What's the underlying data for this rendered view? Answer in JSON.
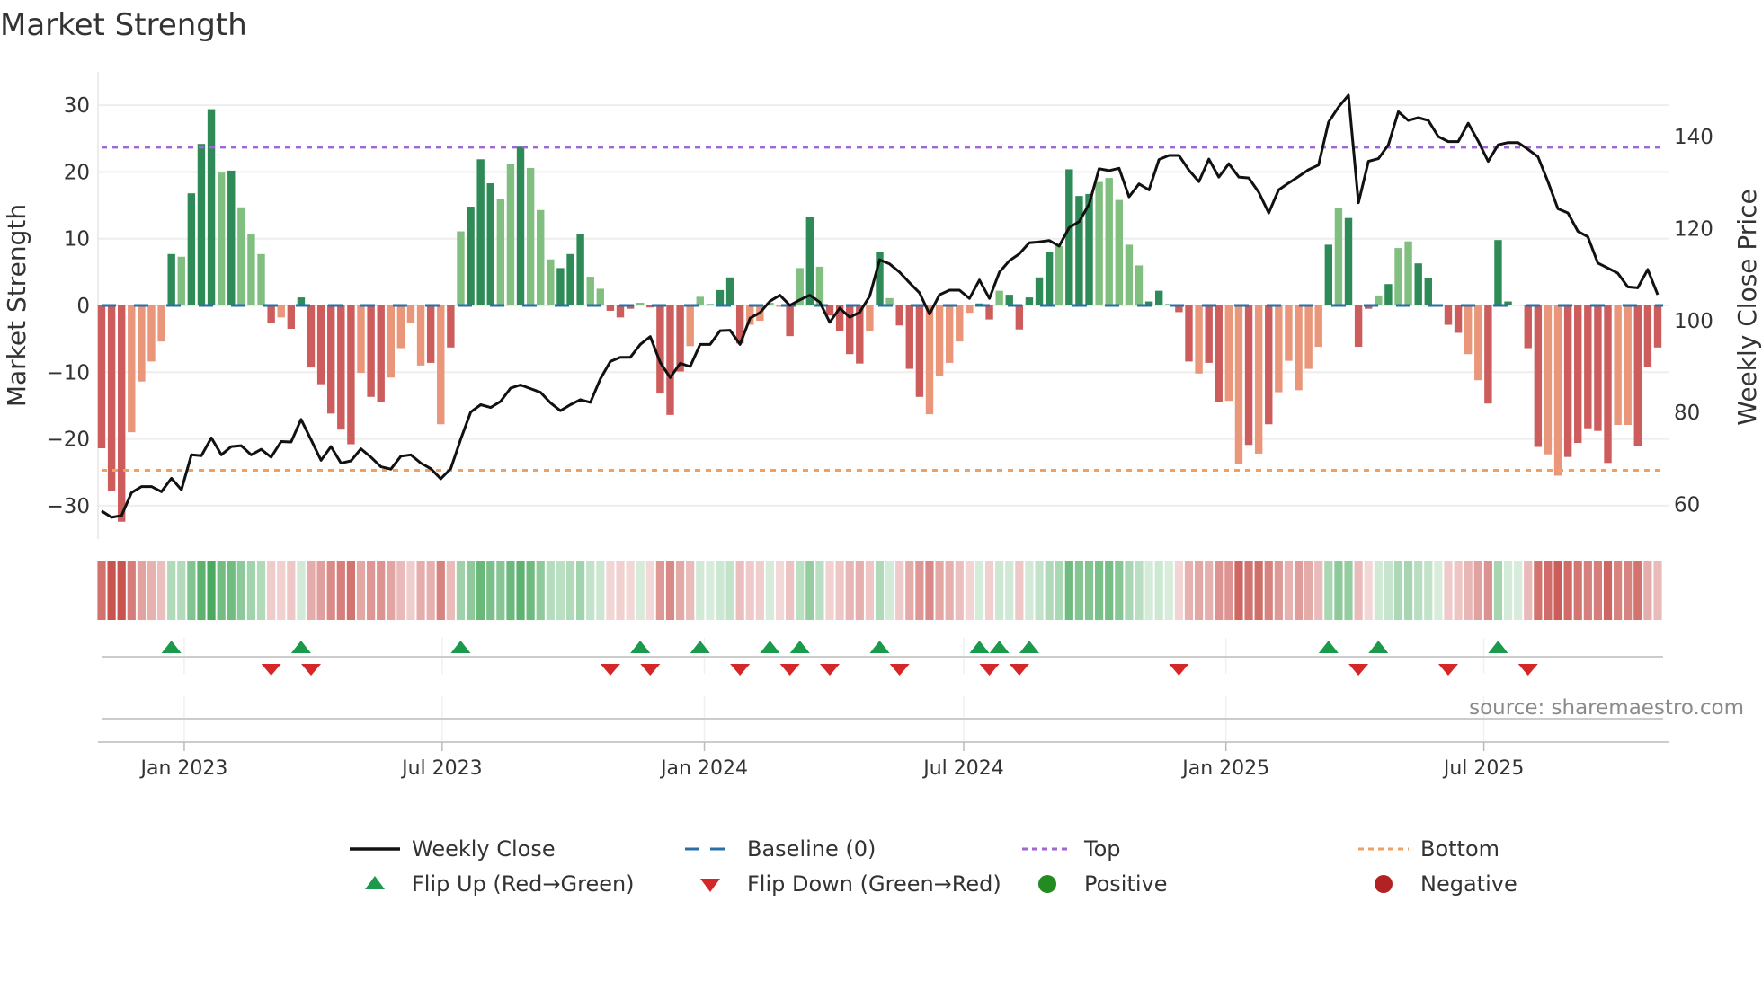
{
  "title": "Market Strength",
  "source": "source: sharemaestro.com",
  "colors": {
    "pos_dark": "#2e8b57",
    "pos_light": "#80bf80",
    "neg_dark": "#cd5c5c",
    "neg_light": "#e9967a",
    "close": "#111111",
    "baseline": "#2a6fa8",
    "top": "#a066d3",
    "bottom": "#f0a060",
    "flip_up": "#1a9a4a",
    "flip_down": "#d62728",
    "positive": "#228b22",
    "negative": "#b22222"
  },
  "legend": [
    {
      "label": "Weekly Close",
      "icon": "line-icon"
    },
    {
      "label": "Baseline (0)",
      "icon": "dashed-line-icon"
    },
    {
      "label": "Top",
      "icon": "dotted-line-icon"
    },
    {
      "label": "Bottom",
      "icon": "dotted-line-icon"
    },
    {
      "label": "Flip Up (Red→Green)",
      "icon": "triangle-up-icon"
    },
    {
      "label": "Flip Down (Green→Red)",
      "icon": "triangle-down-icon"
    },
    {
      "label": "Positive",
      "icon": "circle-icon"
    },
    {
      "label": "Negative",
      "icon": "circle-icon"
    }
  ],
  "chart_data": {
    "type": "bar",
    "title": "Market Strength",
    "ylabel": "Market Strength",
    "y2label": "Weekly Close Price",
    "ylim": [
      -33,
      33
    ],
    "y2lim": [
      55,
      151
    ],
    "yticks": [
      -30,
      -20,
      -10,
      0,
      10,
      20,
      30
    ],
    "y2ticks": [
      60,
      80,
      100,
      120,
      140
    ],
    "start_date": "2022-11-04",
    "frequency": "weekly",
    "xticks": [
      {
        "label": "Jan 2023",
        "date": "2023-01-01"
      },
      {
        "label": "Jul 2023",
        "date": "2023-07-01"
      },
      {
        "label": "Jan 2024",
        "date": "2024-01-01"
      },
      {
        "label": "Jul 2024",
        "date": "2024-07-01"
      },
      {
        "label": "Jan 2025",
        "date": "2025-01-01"
      },
      {
        "label": "Jul 2025",
        "date": "2025-07-01"
      }
    ],
    "top_level": 23.7,
    "bottom_level": -24.7,
    "baseline": 0,
    "strength": [
      -21.4,
      -27.8,
      -32.4,
      -19,
      -11.4,
      -8.4,
      -5.4,
      7.7,
      7.3,
      16.8,
      24.2,
      29.4,
      19.9,
      20.2,
      14.7,
      10.7,
      7.7,
      -2.7,
      -1.8,
      -3.5,
      1.2,
      -9.3,
      -11.8,
      -16.2,
      -18.6,
      -20.8,
      -10.1,
      -13.7,
      -14.4,
      -10.8,
      -6.4,
      -2.6,
      -9,
      -8.6,
      -17.8,
      -6.3,
      11.1,
      14.8,
      21.9,
      18.3,
      15.9,
      21.2,
      23.8,
      20.6,
      14.3,
      6.9,
      5.6,
      7.7,
      10.7,
      4.3,
      2.5,
      -0.8,
      -1.8,
      -0.5,
      0.4,
      -0.3,
      -13.2,
      -16.4,
      -9.9,
      -6.1,
      1.3,
      0.2,
      2.3,
      4.2,
      -5.7,
      -2.9,
      -2.3,
      0.4,
      -0.2,
      -4.6,
      5.6,
      13.2,
      5.8,
      -1.5,
      -3.9,
      -7.3,
      -8.7,
      -3.9,
      8,
      1.1,
      -3,
      -9.5,
      -13.7,
      -16.3,
      -10.5,
      -8.6,
      -5.4,
      -1.1,
      0.3,
      -2.1,
      2.2,
      1.6,
      -3.6,
      1.2,
      4.2,
      8,
      8.9,
      20.4,
      16.4,
      16.7,
      18.5,
      19.1,
      15.8,
      9.1,
      6,
      0.6,
      2.2,
      0.2,
      -1,
      -8.4,
      -10.2,
      -8.6,
      -14.5,
      -14.3,
      -23.8,
      -20.9,
      -22.2,
      -17.8,
      -13,
      -8.3,
      -12.7,
      -9.5,
      -6.2,
      9.1,
      14.6,
      13.1,
      -6.2,
      -0.5,
      1.5,
      3.2,
      8.6,
      9.6,
      6.3,
      4.1,
      0.2,
      -2.9,
      -4.1,
      -7.3,
      -11.2,
      -14.7,
      9.8,
      0.6,
      0.1,
      -6.4,
      -21.2,
      -22.3,
      -25.5,
      -22.7,
      -20.6,
      -18.4,
      -18.8,
      -23.6,
      -17.9,
      -17.9,
      -21.1,
      -9.2,
      -6.3
    ],
    "shade": "dddlllldldddldllldldddddddlddlllldldldddlldllldddlldddlddddllddddlllldldlddddldldddlllllddldddddldddllllldddddlddlldldllllldldddldlldddddllddddddlldddddlldddllldlldll",
    "close": [
      58.6,
      57.2,
      57.6,
      62.6,
      63.9,
      63.9,
      62.8,
      65.7,
      63.2,
      70.8,
      70.6,
      74.5,
      70.8,
      72.6,
      72.8,
      70.8,
      72,
      70.3,
      73.7,
      73.6,
      78.5,
      74.1,
      69.6,
      72.6,
      69,
      69.5,
      72.1,
      70.3,
      68.2,
      67.7,
      70.5,
      70.8,
      69,
      67.8,
      65.6,
      67.8,
      74.2,
      80.1,
      81.7,
      81.1,
      82.4,
      85.3,
      86,
      85.2,
      84.4,
      82.1,
      80.4,
      81.7,
      82.8,
      82.2,
      87.3,
      91.1,
      92,
      92,
      94.8,
      96.5,
      90.9,
      87.6,
      90.7,
      90,
      94.8,
      94.8,
      97.8,
      97.9,
      94.8,
      100.5,
      101.7,
      104.2,
      105.5,
      103.3,
      104.5,
      105.5,
      104,
      99.6,
      102.7,
      100.7,
      101.8,
      105.3,
      113.2,
      112.3,
      110.5,
      108.2,
      106,
      101.4,
      105.6,
      106.6,
      106.6,
      104.8,
      108.8,
      104.8,
      110.5,
      113,
      114.5,
      116.9,
      117.1,
      117.4,
      116.2,
      120.2,
      121.5,
      125.3,
      133,
      132.6,
      133.1,
      126.9,
      129.7,
      128.4,
      135,
      135.9,
      135.9,
      132.7,
      130.2,
      135.1,
      131.2,
      134.1,
      131.2,
      131,
      127.9,
      123.4,
      128.4,
      129.9,
      131.3,
      132.8,
      133.8,
      143.1,
      146.4,
      149,
      125.6,
      134.6,
      135.2,
      138.2,
      145.4,
      143.5,
      144.1,
      143.5,
      140,
      138.9,
      138.9,
      142.9,
      139,
      134.6,
      138.2,
      138.7,
      138.7,
      137.2,
      135.6,
      130.2,
      124.3,
      123.4,
      119.4,
      118.2,
      112.5,
      111.4,
      110.3,
      107.3,
      107.1,
      111.1,
      105.6
    ],
    "flip_up_weeks": [
      8,
      21,
      37,
      55,
      61,
      68,
      71,
      79,
      89,
      91,
      94,
      124,
      129,
      141
    ],
    "flip_down_weeks": [
      18,
      22,
      52,
      56,
      65,
      70,
      74,
      81,
      90,
      93,
      109,
      127,
      136,
      144
    ]
  }
}
